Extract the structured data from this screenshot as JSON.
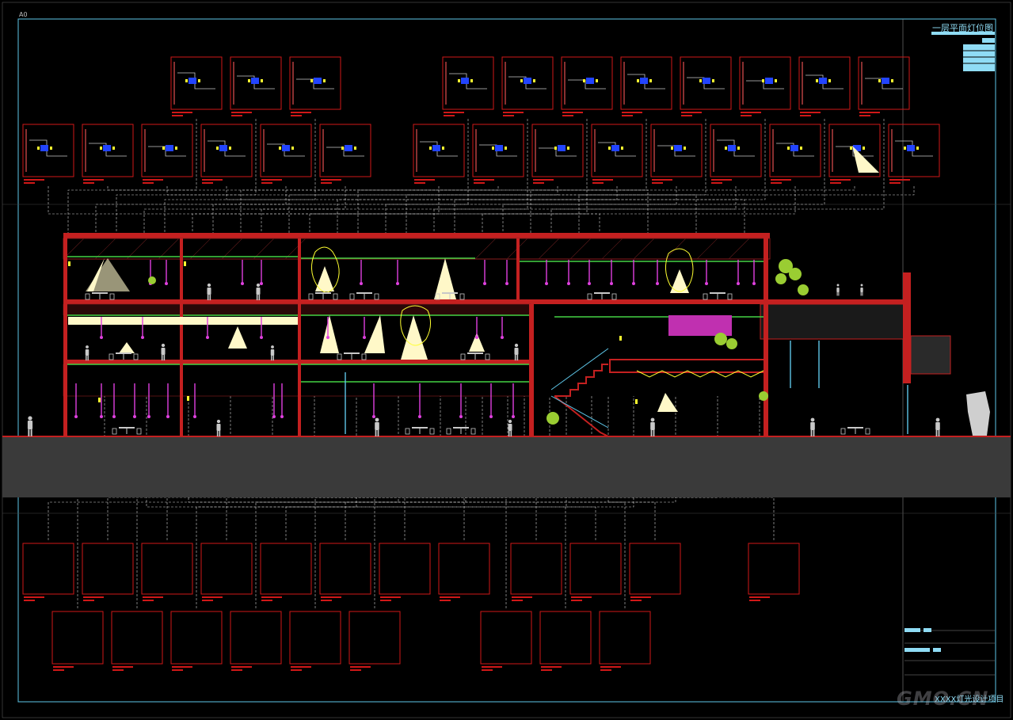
{
  "sheet": {
    "sheet_label": "A0",
    "drawing_title": "一层平面灯位图",
    "project_name": "XXXX灯光设计项目",
    "watermark": "GMO.CN"
  },
  "colors": {
    "background": "#000000",
    "frame": "#5ec6e8",
    "detail_box": "#d01818",
    "wall": "#c42020",
    "floor_green": "#44d244",
    "fixture_magenta": "#e040e0",
    "fixture_yellow": "#ffff30",
    "light_beam": "#fff8c8",
    "figure_gray": "#c8c8c8",
    "ground_band": "#3a3a3a"
  },
  "icons": {
    "people": "person-silhouette-icon",
    "plants": "plant-icon",
    "lights": "pendant-light-icon"
  }
}
